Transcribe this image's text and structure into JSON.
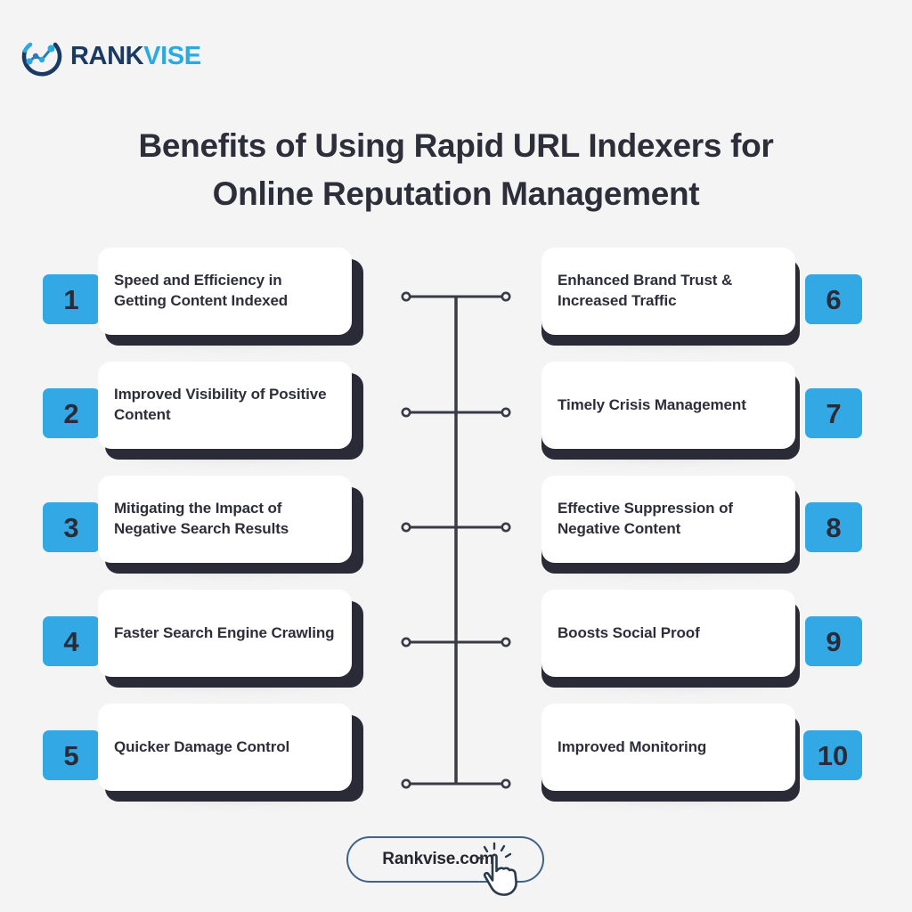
{
  "background_color": "#f4f4f4",
  "accent_color": "#32a9e5",
  "dark_color": "#2b2b38",
  "logo": {
    "icon": "rankvise-chart-circle-icon",
    "text_part1": "RANK",
    "text_part2": "VISE",
    "color_part1": "#1b3a63",
    "color_part2": "#29abe2"
  },
  "title": {
    "line1": "Benefits of Using Rapid URL Indexers for",
    "line2": "Online Reputation Management"
  },
  "items_left": [
    {
      "number": "1",
      "label": "Speed and Efficiency in Getting Content Indexed"
    },
    {
      "number": "2",
      "label": "Improved Visibility of Positive Content"
    },
    {
      "number": "3",
      "label": "Mitigating the Impact of Negative Search Results"
    },
    {
      "number": "4",
      "label": "Faster Search Engine Crawling"
    },
    {
      "number": "5",
      "label": "Quicker Damage Control"
    }
  ],
  "items_right": [
    {
      "number": "6",
      "label": "Enhanced Brand Trust & Increased Traffic"
    },
    {
      "number": "7",
      "label": "Timely Crisis Management"
    },
    {
      "number": "8",
      "label": "Effective Suppression of Negative Content"
    },
    {
      "number": "9",
      "label": "Boosts Social Proof"
    },
    {
      "number": "10",
      "label": "Improved Monitoring"
    }
  ],
  "connector": {
    "node_icon": "connector-node-circle-icon",
    "line_color": "#3a3a47"
  },
  "footer": {
    "label": "Rankvise.com",
    "cursor_icon": "pointing-hand-cursor-icon",
    "border_color": "#3f6389"
  }
}
